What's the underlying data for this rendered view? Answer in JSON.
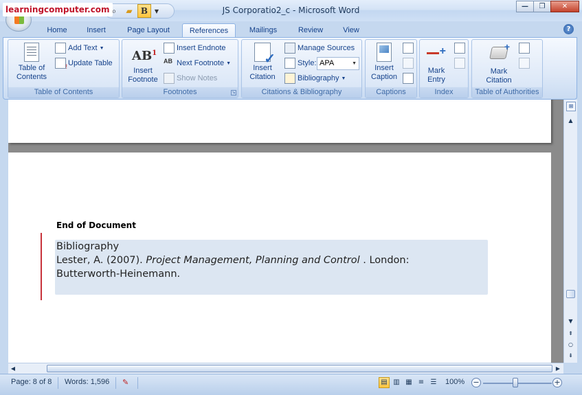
{
  "window": {
    "title": "JS Corporatio2_c - Microsoft Word",
    "watermark": "learningcomputer.com",
    "controls": {
      "minimize": "—",
      "restore": "❐",
      "close": "✕"
    }
  },
  "quick_access": [
    {
      "name": "print-preview-icon",
      "glyph": "🔍"
    },
    {
      "name": "open-folder-icon",
      "glyph": "📂"
    },
    {
      "name": "bold-icon",
      "glyph": "B"
    },
    {
      "name": "customize-qat-icon",
      "glyph": "▾"
    }
  ],
  "tabs": [
    "Home",
    "Insert",
    "Page Layout",
    "References",
    "Mailings",
    "Review",
    "View"
  ],
  "active_tab": "References",
  "ribbon": {
    "toc": {
      "label": "Table of Contents",
      "table_of_contents": "Table of\nContents",
      "add_text": "Add Text",
      "update_table": "Update Table"
    },
    "footnotes": {
      "label": "Footnotes",
      "insert_footnote": "Insert\nFootnote",
      "insert_endnote": "Insert Endnote",
      "next_footnote": "Next Footnote",
      "show_notes": "Show Notes"
    },
    "citations": {
      "label": "Citations & Bibliography",
      "insert_citation": "Insert\nCitation",
      "manage_sources": "Manage Sources",
      "style_label": "Style:",
      "style_value": "APA",
      "bibliography": "Bibliography"
    },
    "captions": {
      "label": "Captions",
      "insert_caption": "Insert\nCaption"
    },
    "index": {
      "label": "Index",
      "mark_entry": "Mark\nEntry"
    },
    "authorities": {
      "label": "Table of Authorities",
      "mark_citation": "Mark\nCitation"
    }
  },
  "document": {
    "heading": "End of Document",
    "bibliography_title": "Bibliography",
    "entry_author": "Lester, A. (2007). ",
    "entry_title": "Project Management, Planning and Control",
    "entry_rest_1": " . London:",
    "entry_rest_2": "Butterworth-Heinemann."
  },
  "status": {
    "page": "Page: 8 of 8",
    "words": "Words: 1,596",
    "zoom": "100%",
    "zoom_level_percent": 100
  }
}
